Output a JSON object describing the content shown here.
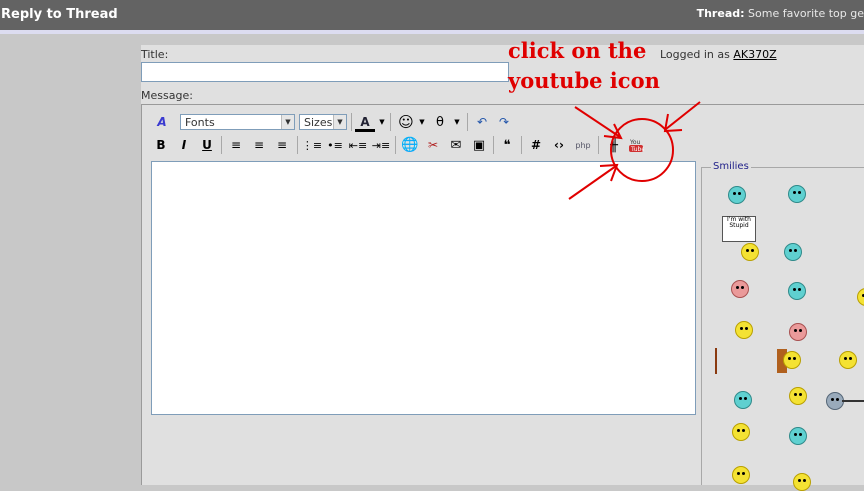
{
  "header": {
    "title": "Reply to Thread",
    "thread_label": "Thread:",
    "thread_title": "Some favorite top ge"
  },
  "form": {
    "title_label": "Title:",
    "title_value": "",
    "message_label": "Message:",
    "logged_in_text": "Logged in as",
    "username": "AK370Z"
  },
  "toolbar": {
    "font_select": "Fonts",
    "size_select": "Sizes"
  },
  "smilies": {
    "legend": "Smilies",
    "sign_text": "I'm with Stupid"
  },
  "annotation": {
    "line1": "click on the",
    "line2": "youtube icon"
  },
  "colors": {
    "header_bg": "#636363",
    "annotation": "#e00000",
    "youtube": "#d03030"
  }
}
